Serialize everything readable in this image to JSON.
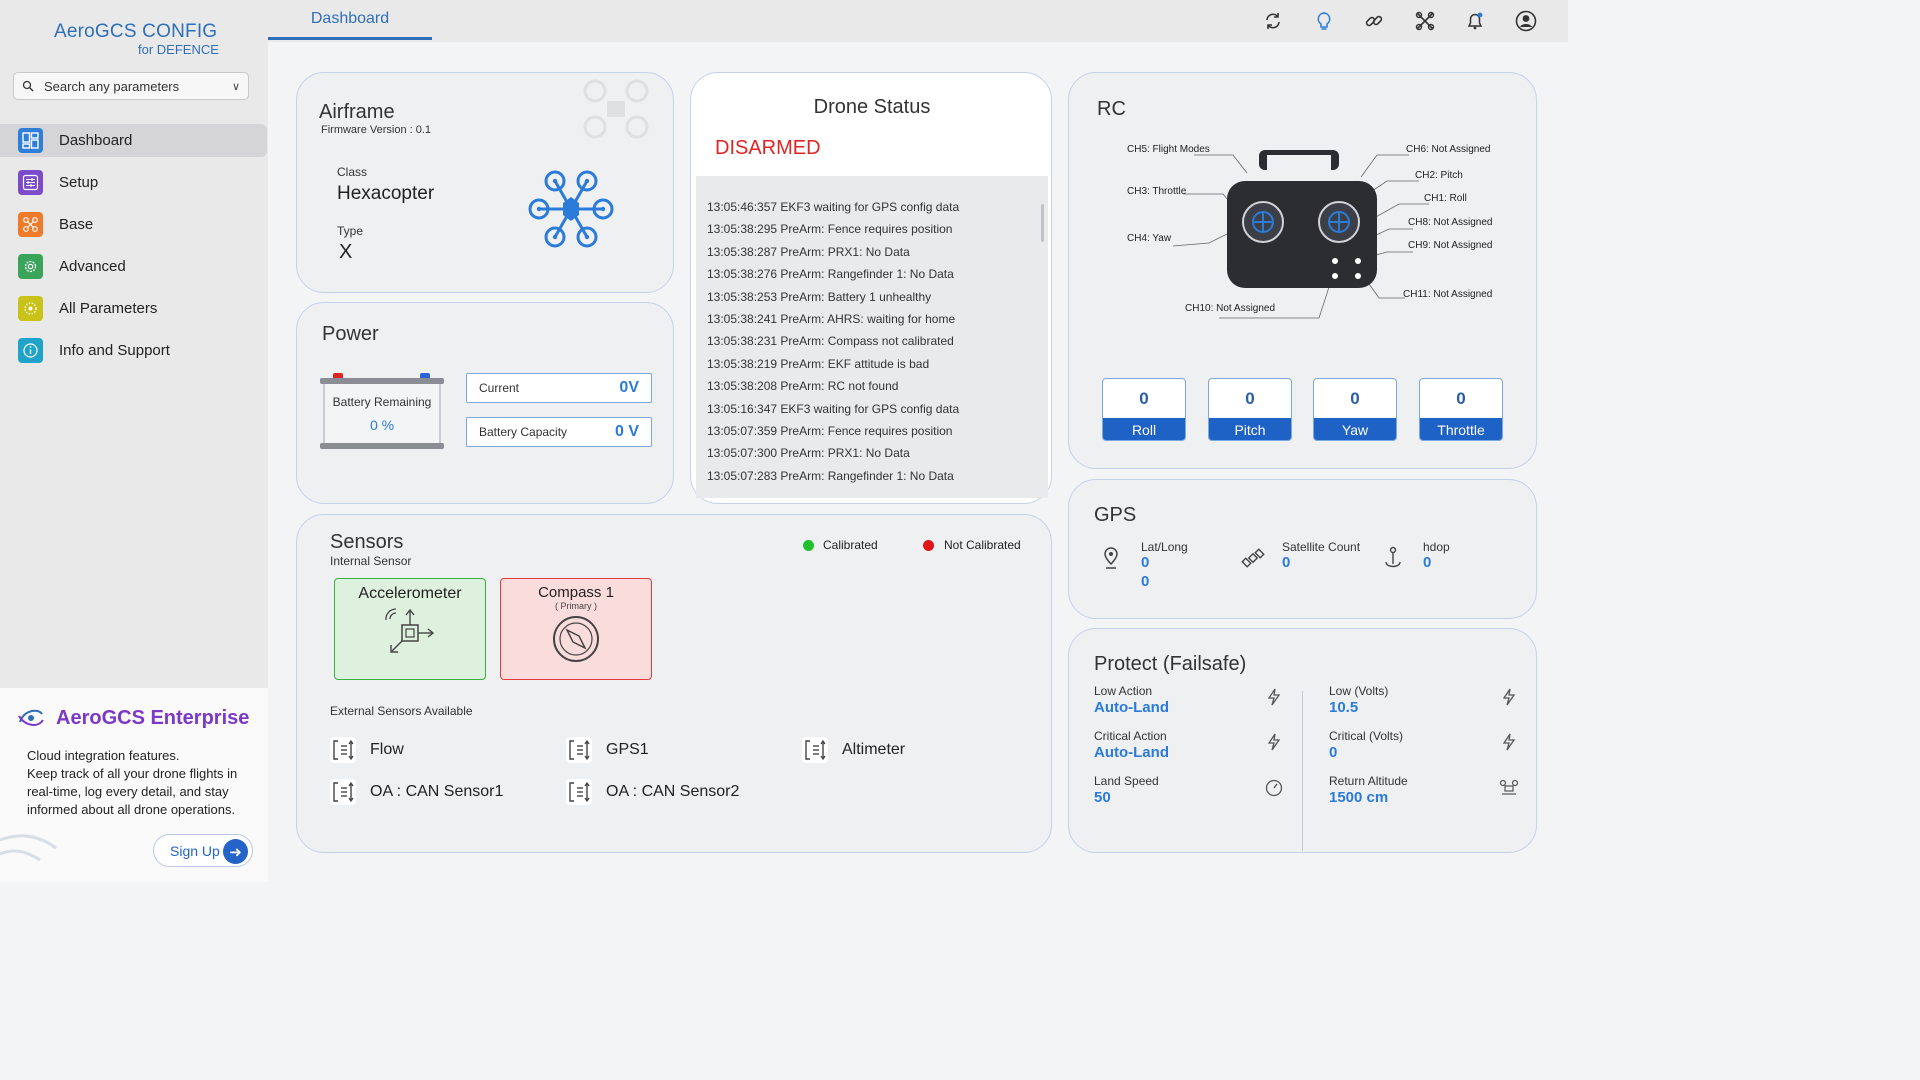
{
  "brand": {
    "title": "AeroGCS CONFIG",
    "subtitle": "for DEFENCE"
  },
  "search": {
    "placeholder": "Search any parameters"
  },
  "sidebar": {
    "items": [
      {
        "label": "Dashboard",
        "color": "#2f7fd8"
      },
      {
        "label": "Setup",
        "color": "#7b4bc9"
      },
      {
        "label": "Base",
        "color": "#ef7b2a"
      },
      {
        "label": "Advanced",
        "color": "#3aa55a"
      },
      {
        "label": "All Parameters",
        "color": "#c9c219"
      },
      {
        "label": "Info and Support",
        "color": "#1fa3c9"
      }
    ]
  },
  "enterprise": {
    "title": "AeroGCS Enterprise",
    "line1": "Cloud integration features.",
    "line2": "Keep track of all your drone flights in real-time, log every detail, and stay informed about all drone operations.",
    "signup": "Sign Up"
  },
  "topbar": {
    "tab": "Dashboard"
  },
  "airframe": {
    "title": "Airframe",
    "firmware": "Firmware Version : 0.1",
    "class_label": "Class",
    "class_value": "Hexacopter",
    "type_label": "Type",
    "type_value": "X"
  },
  "power": {
    "title": "Power",
    "battery_label": "Battery Remaining",
    "battery_value": "0 %",
    "current_label": "Current",
    "current_value": "0V",
    "capacity_label": "Battery Capacity",
    "capacity_value": "0 V"
  },
  "drone_status": {
    "title": "Drone Status",
    "state": "DISARMED",
    "log": [
      "13:05:46:357 EKF3 waiting for GPS config data",
      "13:05:38:295 PreArm: Fence requires position",
      "13:05:38:287 PreArm: PRX1: No Data",
      "13:05:38:276 PreArm: Rangefinder 1: No Data",
      "13:05:38:253 PreArm: Battery 1 unhealthy",
      "13:05:38:241 PreArm: AHRS: waiting for home",
      "13:05:38:231 PreArm: Compass not calibrated",
      "13:05:38:219 PreArm: EKF attitude is bad",
      "13:05:38:208 PreArm: RC not found",
      "13:05:16:347 EKF3 waiting for GPS config data",
      "13:05:07:359 PreArm: Fence requires position",
      "13:05:07:300 PreArm: PRX1: No Data",
      "13:05:07:283 PreArm: Rangefinder 1: No Data"
    ]
  },
  "rc": {
    "title": "RC",
    "labels": {
      "ch5": "CH5: Flight Modes",
      "ch6": "CH6: Not Assigned",
      "ch2": "CH2: Pitch",
      "ch3": "CH3: Throttle",
      "ch1": "CH1: Roll",
      "ch8": "CH8: Not Assigned",
      "ch4": "CH4: Yaw",
      "ch9": "CH9: Not Assigned",
      "ch11": "CH11: Not Assigned",
      "ch10": "CH10: Not Assigned"
    },
    "channels": [
      {
        "label": "Roll",
        "value": "0"
      },
      {
        "label": "Pitch",
        "value": "0"
      },
      {
        "label": "Yaw",
        "value": "0"
      },
      {
        "label": "Throttle",
        "value": "0"
      }
    ]
  },
  "sensors": {
    "title": "Sensors",
    "subtitle": "Internal Sensor",
    "legend_ok": "Calibrated",
    "legend_bad": "Not Calibrated",
    "accel": "Accelerometer",
    "compass": "Compass 1",
    "compass_sub": "( Primary )",
    "external_title": "External Sensors Available",
    "external": [
      "Flow",
      "GPS1",
      "Altimeter",
      "OA : CAN Sensor1",
      "OA : CAN Sensor2"
    ]
  },
  "gps": {
    "title": "GPS",
    "latlong_label": "Lat/Long",
    "lat": "0",
    "long": "0",
    "sat_label": "Satellite Count",
    "sat": "0",
    "hdop_label": "hdop",
    "hdop": "0"
  },
  "failsafe": {
    "title": "Protect (Failsafe)",
    "low_action_label": "Low Action",
    "low_action": "Auto-Land",
    "low_volts_label": "Low (Volts)",
    "low_volts": "10.5",
    "crit_action_label": "Critical Action",
    "crit_action": "Auto-Land",
    "crit_volts_label": "Critical (Volts)",
    "crit_volts": "0",
    "land_speed_label": "Land Speed",
    "land_speed": "50",
    "rtl_alt_label": "Return Altitude",
    "rtl_alt": "1500 cm"
  }
}
